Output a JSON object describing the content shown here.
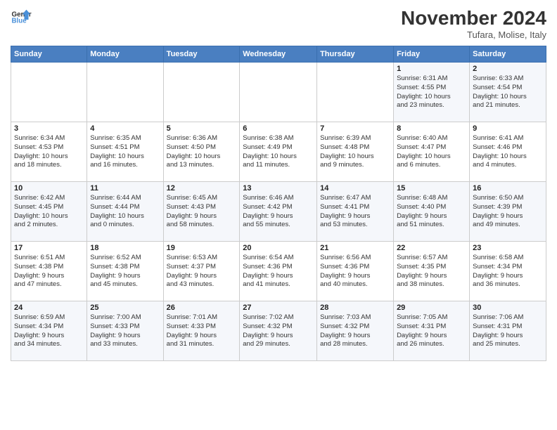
{
  "logo": {
    "line1": "General",
    "line2": "Blue"
  },
  "title": "November 2024",
  "location": "Tufara, Molise, Italy",
  "days_of_week": [
    "Sunday",
    "Monday",
    "Tuesday",
    "Wednesday",
    "Thursday",
    "Friday",
    "Saturday"
  ],
  "weeks": [
    [
      {
        "day": "",
        "info": ""
      },
      {
        "day": "",
        "info": ""
      },
      {
        "day": "",
        "info": ""
      },
      {
        "day": "",
        "info": ""
      },
      {
        "day": "",
        "info": ""
      },
      {
        "day": "1",
        "info": "Sunrise: 6:31 AM\nSunset: 4:55 PM\nDaylight: 10 hours\nand 23 minutes."
      },
      {
        "day": "2",
        "info": "Sunrise: 6:33 AM\nSunset: 4:54 PM\nDaylight: 10 hours\nand 21 minutes."
      }
    ],
    [
      {
        "day": "3",
        "info": "Sunrise: 6:34 AM\nSunset: 4:53 PM\nDaylight: 10 hours\nand 18 minutes."
      },
      {
        "day": "4",
        "info": "Sunrise: 6:35 AM\nSunset: 4:51 PM\nDaylight: 10 hours\nand 16 minutes."
      },
      {
        "day": "5",
        "info": "Sunrise: 6:36 AM\nSunset: 4:50 PM\nDaylight: 10 hours\nand 13 minutes."
      },
      {
        "day": "6",
        "info": "Sunrise: 6:38 AM\nSunset: 4:49 PM\nDaylight: 10 hours\nand 11 minutes."
      },
      {
        "day": "7",
        "info": "Sunrise: 6:39 AM\nSunset: 4:48 PM\nDaylight: 10 hours\nand 9 minutes."
      },
      {
        "day": "8",
        "info": "Sunrise: 6:40 AM\nSunset: 4:47 PM\nDaylight: 10 hours\nand 6 minutes."
      },
      {
        "day": "9",
        "info": "Sunrise: 6:41 AM\nSunset: 4:46 PM\nDaylight: 10 hours\nand 4 minutes."
      }
    ],
    [
      {
        "day": "10",
        "info": "Sunrise: 6:42 AM\nSunset: 4:45 PM\nDaylight: 10 hours\nand 2 minutes."
      },
      {
        "day": "11",
        "info": "Sunrise: 6:44 AM\nSunset: 4:44 PM\nDaylight: 10 hours\nand 0 minutes."
      },
      {
        "day": "12",
        "info": "Sunrise: 6:45 AM\nSunset: 4:43 PM\nDaylight: 9 hours\nand 58 minutes."
      },
      {
        "day": "13",
        "info": "Sunrise: 6:46 AM\nSunset: 4:42 PM\nDaylight: 9 hours\nand 55 minutes."
      },
      {
        "day": "14",
        "info": "Sunrise: 6:47 AM\nSunset: 4:41 PM\nDaylight: 9 hours\nand 53 minutes."
      },
      {
        "day": "15",
        "info": "Sunrise: 6:48 AM\nSunset: 4:40 PM\nDaylight: 9 hours\nand 51 minutes."
      },
      {
        "day": "16",
        "info": "Sunrise: 6:50 AM\nSunset: 4:39 PM\nDaylight: 9 hours\nand 49 minutes."
      }
    ],
    [
      {
        "day": "17",
        "info": "Sunrise: 6:51 AM\nSunset: 4:38 PM\nDaylight: 9 hours\nand 47 minutes."
      },
      {
        "day": "18",
        "info": "Sunrise: 6:52 AM\nSunset: 4:38 PM\nDaylight: 9 hours\nand 45 minutes."
      },
      {
        "day": "19",
        "info": "Sunrise: 6:53 AM\nSunset: 4:37 PM\nDaylight: 9 hours\nand 43 minutes."
      },
      {
        "day": "20",
        "info": "Sunrise: 6:54 AM\nSunset: 4:36 PM\nDaylight: 9 hours\nand 41 minutes."
      },
      {
        "day": "21",
        "info": "Sunrise: 6:56 AM\nSunset: 4:36 PM\nDaylight: 9 hours\nand 40 minutes."
      },
      {
        "day": "22",
        "info": "Sunrise: 6:57 AM\nSunset: 4:35 PM\nDaylight: 9 hours\nand 38 minutes."
      },
      {
        "day": "23",
        "info": "Sunrise: 6:58 AM\nSunset: 4:34 PM\nDaylight: 9 hours\nand 36 minutes."
      }
    ],
    [
      {
        "day": "24",
        "info": "Sunrise: 6:59 AM\nSunset: 4:34 PM\nDaylight: 9 hours\nand 34 minutes."
      },
      {
        "day": "25",
        "info": "Sunrise: 7:00 AM\nSunset: 4:33 PM\nDaylight: 9 hours\nand 33 minutes."
      },
      {
        "day": "26",
        "info": "Sunrise: 7:01 AM\nSunset: 4:33 PM\nDaylight: 9 hours\nand 31 minutes."
      },
      {
        "day": "27",
        "info": "Sunrise: 7:02 AM\nSunset: 4:32 PM\nDaylight: 9 hours\nand 29 minutes."
      },
      {
        "day": "28",
        "info": "Sunrise: 7:03 AM\nSunset: 4:32 PM\nDaylight: 9 hours\nand 28 minutes."
      },
      {
        "day": "29",
        "info": "Sunrise: 7:05 AM\nSunset: 4:31 PM\nDaylight: 9 hours\nand 26 minutes."
      },
      {
        "day": "30",
        "info": "Sunrise: 7:06 AM\nSunset: 4:31 PM\nDaylight: 9 hours\nand 25 minutes."
      }
    ]
  ]
}
